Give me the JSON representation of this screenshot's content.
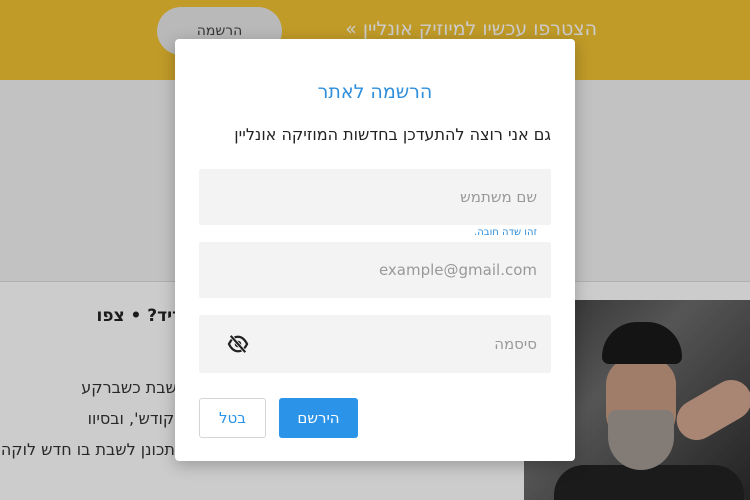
{
  "background": {
    "banner_text": "הצטרפו עכשיו למיוזיק אונליין »",
    "banner_signup_label": "הרשמה",
    "article_title": "אברהם פריד? • צפו",
    "article_lines": [
      "ת ומתכונן לשבת כשברקע",
      "וננים לשבת קודש', ובסיוו",
      "בעקבות המתכונן לשבת בו חדש לוקה הקרוה חדש"
    ]
  },
  "modal": {
    "title": "הרשמה לאתר",
    "newsletter_label": "גם אני רוצה להתעדכן בחדשות המוזיקה אונליין",
    "username_placeholder": "שם משתמש",
    "username_error": "זהו שדה חובה.",
    "email_placeholder": "example@gmail.com",
    "password_placeholder": "סיסמה",
    "register_label": "הירשם",
    "cancel_label": "בטל"
  },
  "colors": {
    "accent": "#2b93e8",
    "banner": "#f1c232"
  },
  "icons": {
    "password_toggle": "eye-off-icon"
  }
}
